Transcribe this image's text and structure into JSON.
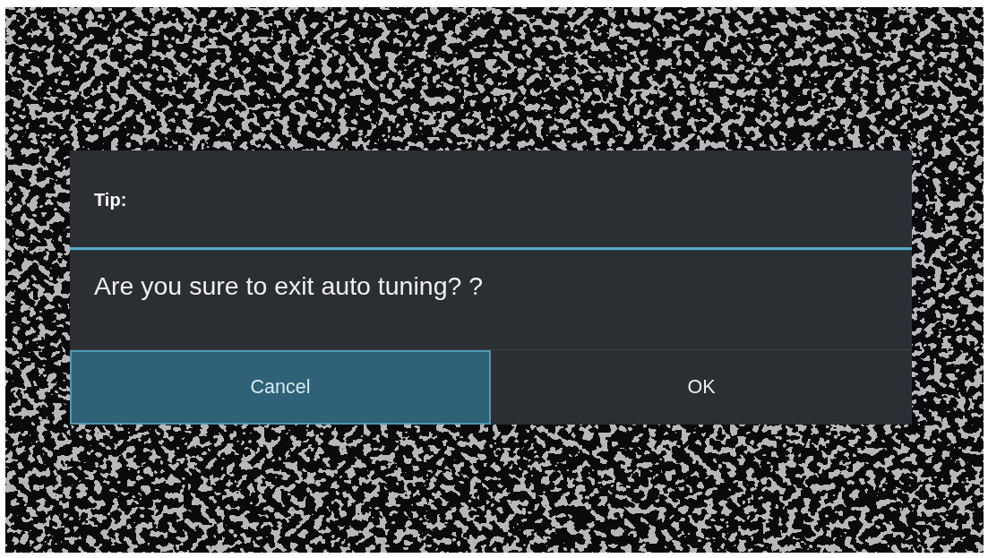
{
  "dialog": {
    "title": "Tip:",
    "message": "Are you sure to exit auto tuning? ?",
    "buttons": [
      {
        "label": "Cancel",
        "selected": true
      },
      {
        "label": "OK",
        "selected": false
      }
    ]
  }
}
